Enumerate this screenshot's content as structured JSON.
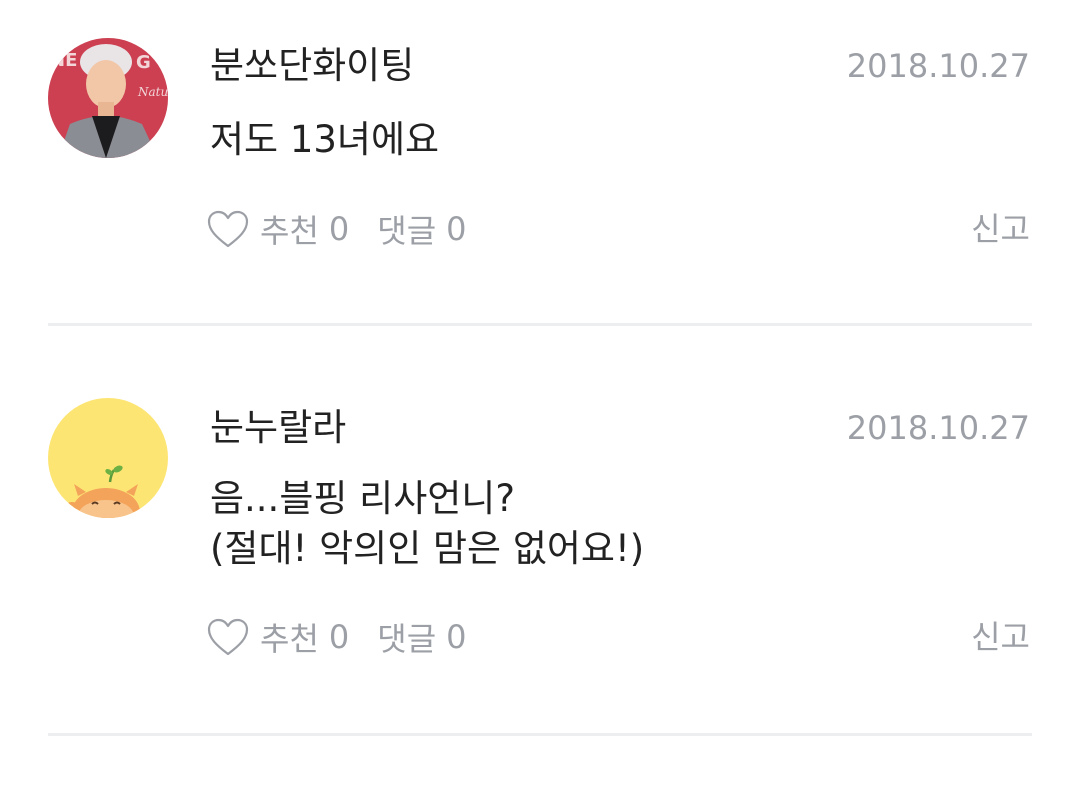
{
  "comments": [
    {
      "author": "분쏘단화이팅",
      "date": "2018.10.27",
      "lines": [
        "저도 13녀에요"
      ],
      "like_label": "추천",
      "like_count": "0",
      "reply_label": "댓글",
      "reply_count": "0",
      "report_label": "신고",
      "avatar_icon": "person-photo-avatar"
    },
    {
      "author": "눈누랄라",
      "date": "2018.10.27",
      "lines": [
        "음...블핑 리사언니?",
        "(절대! 악의인 맘은 없어요!)"
      ],
      "like_label": "추천",
      "like_count": "0",
      "reply_label": "댓글",
      "reply_count": "0",
      "report_label": "신고",
      "avatar_icon": "cartoon-character-avatar"
    }
  ],
  "colors": {
    "text_primary": "#222222",
    "text_secondary": "#9ca0a6",
    "divider": "#eceef0",
    "avatar2_bg": "#fde574"
  }
}
